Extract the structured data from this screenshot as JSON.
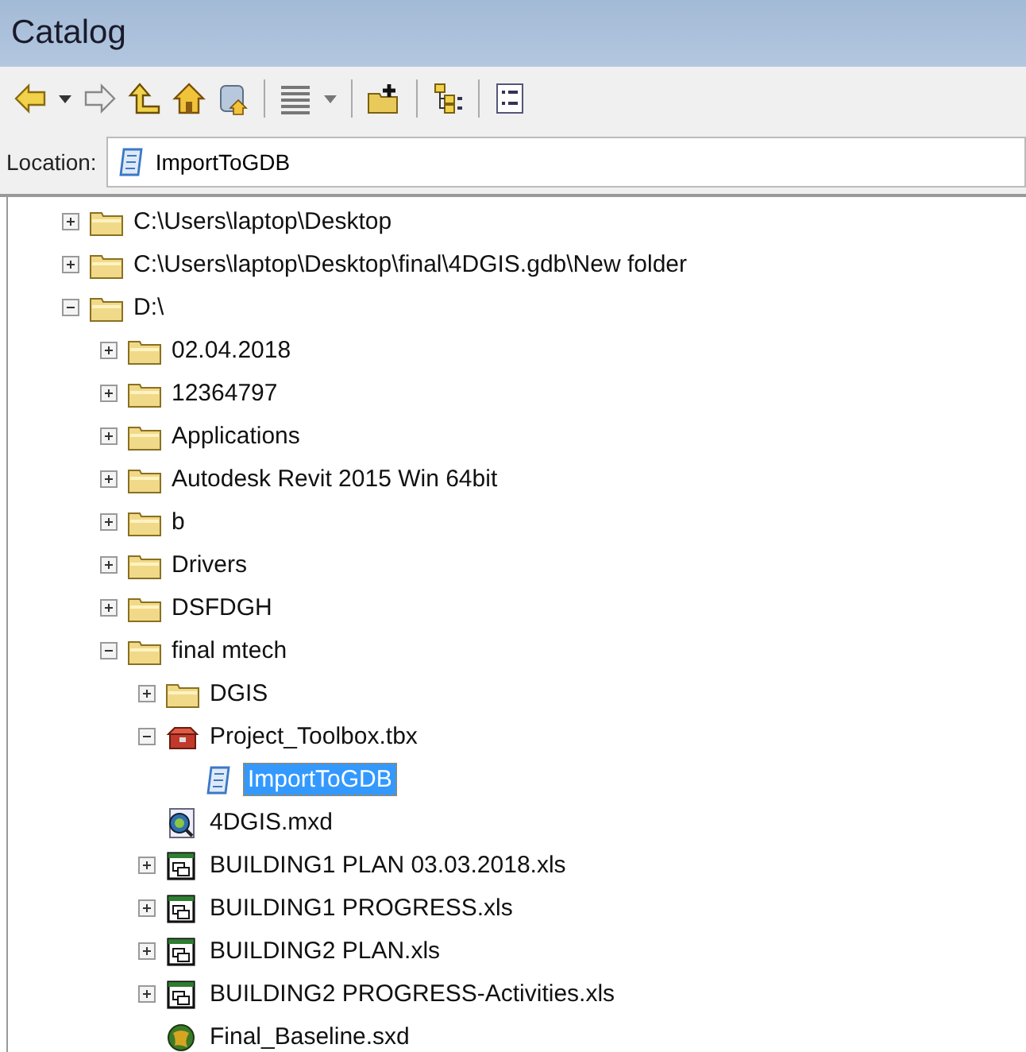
{
  "window": {
    "title": "Catalog"
  },
  "location": {
    "label": "Location:",
    "value": "ImportToGDB"
  },
  "tree": [
    {
      "label": "C:\\Users\\laptop\\Desktop",
      "kind": "folder",
      "expanded": false,
      "selected": false
    },
    {
      "label": "C:\\Users\\laptop\\Desktop\\final\\4DGIS.gdb\\New folder",
      "kind": "folder",
      "expanded": false,
      "selected": false
    },
    {
      "label": "D:\\",
      "kind": "folder",
      "expanded": true,
      "selected": false,
      "children": [
        {
          "label": "02.04.2018",
          "kind": "folder",
          "expanded": false,
          "selected": false
        },
        {
          "label": "12364797",
          "kind": "folder",
          "expanded": false,
          "selected": false
        },
        {
          "label": "Applications",
          "kind": "folder",
          "expanded": false,
          "selected": false
        },
        {
          "label": "Autodesk Revit 2015 Win 64bit",
          "kind": "folder",
          "expanded": false,
          "selected": false
        },
        {
          "label": "b",
          "kind": "folder",
          "expanded": false,
          "selected": false
        },
        {
          "label": "Drivers",
          "kind": "folder",
          "expanded": false,
          "selected": false
        },
        {
          "label": "DSFDGH",
          "kind": "folder",
          "expanded": false,
          "selected": false
        },
        {
          "label": "final mtech",
          "kind": "folder",
          "expanded": true,
          "selected": false,
          "children": [
            {
              "label": "DGIS",
              "kind": "folder",
              "expanded": false,
              "selected": false
            },
            {
              "label": "Project_Toolbox.tbx",
              "kind": "toolbox",
              "expanded": true,
              "selected": false,
              "children": [
                {
                  "label": "ImportToGDB",
                  "kind": "script",
                  "selected": true
                }
              ]
            },
            {
              "label": "4DGIS.mxd",
              "kind": "map",
              "selected": false
            },
            {
              "label": "BUILDING1 PLAN 03.03.2018.xls",
              "kind": "sheet",
              "expanded": false,
              "selected": false
            },
            {
              "label": "BUILDING1 PROGRESS.xls",
              "kind": "sheet",
              "expanded": false,
              "selected": false
            },
            {
              "label": "BUILDING2 PLAN.xls",
              "kind": "sheet",
              "expanded": false,
              "selected": false
            },
            {
              "label": "BUILDING2 PROGRESS-Activities.xls",
              "kind": "sheet",
              "expanded": false,
              "selected": false
            },
            {
              "label": "Final_Baseline.sxd",
              "kind": "globe",
              "selected": false
            }
          ]
        }
      ]
    }
  ]
}
